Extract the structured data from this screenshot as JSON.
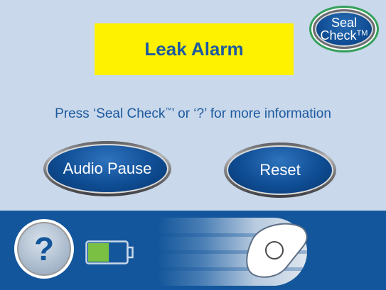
{
  "alarm": {
    "title": "Leak Alarm",
    "color": "#fff200"
  },
  "seal_check_button": {
    "line1": "Seal",
    "line2": "Check",
    "tm": "TM",
    "ring_color": "#33a05a"
  },
  "info": {
    "before": "Press ‘Seal Check",
    "tm": "™",
    "after": "’ or ‘?’ for more information"
  },
  "buttons": {
    "audio_pause": "Audio Pause",
    "reset": "Reset"
  },
  "bottom_bar": {
    "help_label": "?",
    "help_icon": "question-mark-icon",
    "battery_icon": "battery-icon",
    "battery_level": 0.55,
    "battery_fill_color": "#7ac143",
    "slider_icon": "unlock-slider-icon"
  },
  "colors": {
    "panel_background": "#c9d8ea",
    "bottom_bar": "#13569b",
    "text_blue": "#1d5aa0",
    "button_blue": "#0f4d94"
  }
}
